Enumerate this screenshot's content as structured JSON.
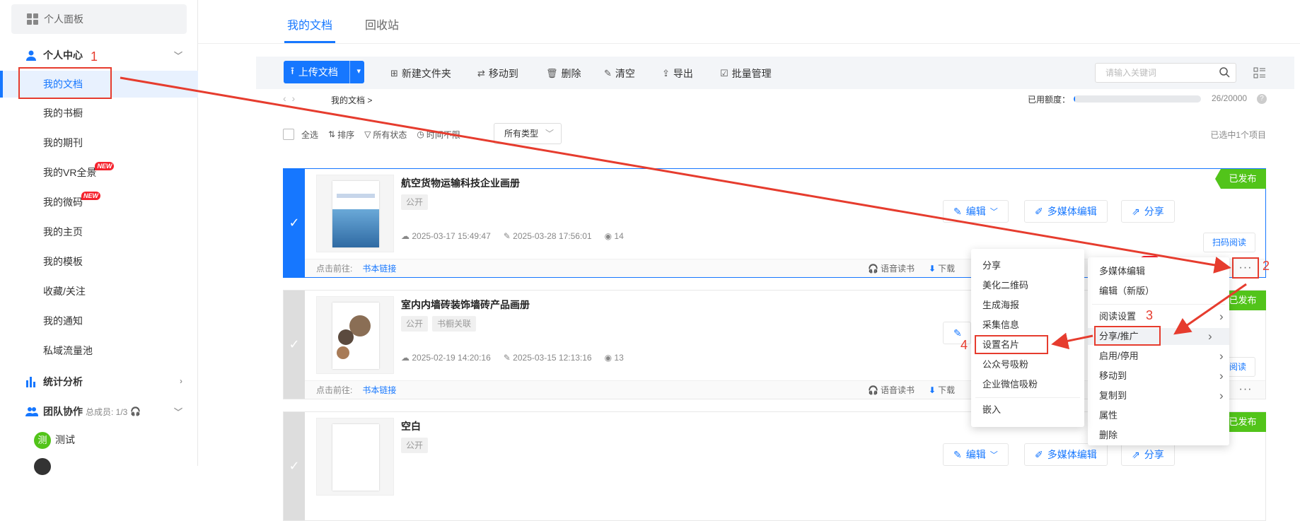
{
  "sidebar": {
    "panel_label": "个人面板",
    "personal_center": "个人中心",
    "items": [
      "我的文档",
      "我的书橱",
      "我的期刊",
      "我的VR全景",
      "我的微码",
      "我的主页",
      "我的模板",
      "收藏/关注",
      "我的通知",
      "私域流量池"
    ],
    "new_badge": "NEW",
    "stats": "统计分析",
    "team": "团队协作",
    "team_members": "总成员: 1/3",
    "member_name": "测试",
    "member_avatar": "测"
  },
  "tabs": [
    "我的文档",
    "回收站"
  ],
  "toolbar": {
    "upload": "上传文档",
    "new_folder": "新建文件夹",
    "move_to": "移动到",
    "delete": "删除",
    "clear": "清空",
    "export": "导出",
    "batch": "批量管理",
    "search_placeholder": "请输入关键词"
  },
  "breadcrumb": "我的文档 >",
  "quota": {
    "label": "已用额度：",
    "count": "26/20000",
    "used_fraction": 0.0013
  },
  "filters": {
    "select_all": "全选",
    "sort": "排序",
    "status": "所有状态",
    "time": "时间不限",
    "type": "所有类型",
    "selected_count": "已选中1个项目"
  },
  "card_actions": {
    "edit": "编辑",
    "media_edit": "多媒体编辑",
    "share": "分享",
    "scan_read": "扫码阅读",
    "goto": "点击前往:",
    "book_link": "书本链接",
    "voice": "语音读书",
    "download": "下载",
    "published": "已发布"
  },
  "documents": [
    {
      "title": "航空货物运输科技企业画册",
      "tags": [
        "公开"
      ],
      "created": "2025-03-17 15:49:47",
      "modified": "2025-03-28 17:56:01",
      "views": "14",
      "selected": true
    },
    {
      "title": "室内内墙砖装饰墙砖产品画册",
      "tags": [
        "公开",
        "书橱关联"
      ],
      "created": "2025-02-19 14:20:16",
      "modified": "2025-03-15 12:13:16",
      "views": "13",
      "selected": false
    },
    {
      "title": "空白",
      "tags": [
        "公开"
      ],
      "created": "",
      "modified": "",
      "views": "",
      "selected": false
    }
  ],
  "more_menu": {
    "items": [
      "多媒体编辑",
      "编辑（新版）",
      "阅读设置",
      "分享/推广",
      "启用/停用",
      "移动到",
      "复制到",
      "属性",
      "删除"
    ]
  },
  "share_submenu": {
    "items": [
      "分享",
      "美化二维码",
      "生成海报",
      "采集信息",
      "设置名片",
      "公众号吸粉",
      "企业微信吸粉",
      "嵌入"
    ]
  },
  "annotations": [
    "1",
    "2",
    "3",
    "4"
  ],
  "colors": {
    "accent": "#1677ff",
    "annotation": "#e63c2e",
    "published": "#52c41a"
  }
}
